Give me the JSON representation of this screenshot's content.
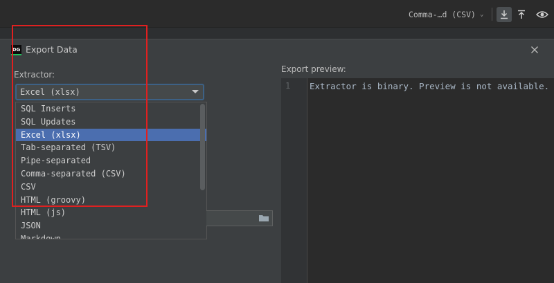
{
  "toolbar": {
    "format_select": "Comma-…d (CSV)",
    "icons": [
      "download-icon",
      "upload-icon",
      "eye-icon"
    ]
  },
  "dialog": {
    "logo_text": "DG",
    "title": "Export Data",
    "extractor_label": "Extractor:",
    "extractor_selected": "Excel (xlsx)",
    "extractor_options": [
      "SQL Inserts",
      "SQL Updates",
      "Excel (xlsx)",
      "Tab-separated (TSV)",
      "Pipe-separated",
      "Comma-separated (CSV)",
      "CSV",
      "HTML (groovy)",
      "HTML (js)",
      "JSON",
      "Markdown"
    ],
    "selected_index": 2,
    "preview_label": "Export preview:",
    "preview_line_number": "1",
    "preview_text": "Extractor is binary. Preview is not available."
  },
  "colors": {
    "selection": "#4b6eaf",
    "highlight_box": "#e02020",
    "focus_border": "#3d6185"
  }
}
